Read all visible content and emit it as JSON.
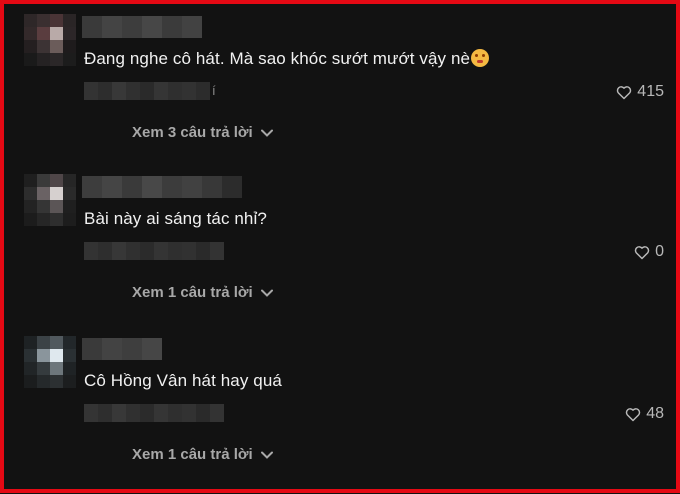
{
  "comments": [
    {
      "text": "Đang nghe cô hát. Mà sao khóc sướt mướt vậy nè",
      "emoji": "flushed-face-emoji",
      "meta_tail": "í",
      "likes": "415",
      "replies_label": "Xem 3 câu trả lời"
    },
    {
      "text": "Bài này ai sáng tác nhỉ?",
      "likes": "0",
      "replies_label": "Xem 1 câu trả lời"
    },
    {
      "text": "Cô Hồng Vân hát hay quá",
      "likes": "48",
      "replies_label": "Xem 1 câu trả lời"
    }
  ],
  "colors": {
    "frame_border": "#e50914",
    "background": "#121212",
    "text": "#f1f1f1",
    "muted": "#a8a8a8"
  },
  "icons": [
    "heart-icon",
    "chevron-down-icon"
  ]
}
